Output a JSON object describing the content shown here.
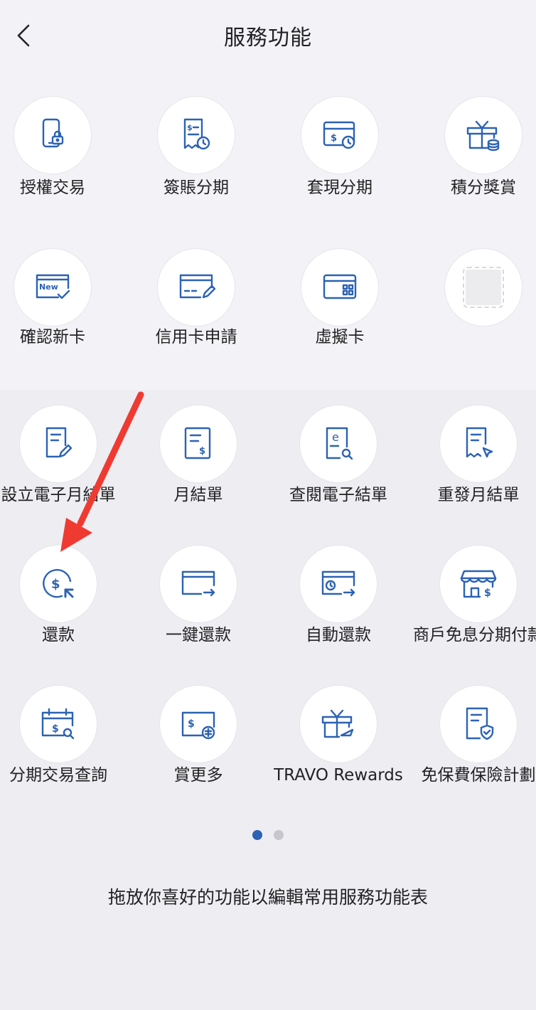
{
  "header": {
    "title": "服務功能",
    "back_icon": "chevron-left-icon"
  },
  "favorites": [
    {
      "label": "授權交易",
      "icon": "phone-lock-icon"
    },
    {
      "label": "簽賬分期",
      "icon": "receipt-clock-icon"
    },
    {
      "label": "套現分期",
      "icon": "card-dollar-clock-icon"
    },
    {
      "label": "積分獎賞",
      "icon": "gift-coins-icon"
    },
    {
      "label": "確認新卡",
      "icon": "new-card-check-icon",
      "badge": "New"
    },
    {
      "label": "信用卡申請",
      "icon": "card-pen-icon"
    },
    {
      "label": "虛擬卡",
      "icon": "card-qr-icon"
    },
    {
      "label": "",
      "icon": "empty-slot-icon"
    }
  ],
  "services": [
    {
      "label": "設立電子月結單",
      "icon": "doc-pen-icon"
    },
    {
      "label": "月結單",
      "icon": "doc-dollar-icon"
    },
    {
      "label": "查閱電子結單",
      "icon": "doc-e-search-icon"
    },
    {
      "label": "重發月結單",
      "icon": "receipt-cursor-icon"
    },
    {
      "label": "還款",
      "icon": "dollar-circle-cursor-icon"
    },
    {
      "label": "一鍵還款",
      "icon": "card-arrow-icon"
    },
    {
      "label": "自動還款",
      "icon": "card-clock-arrow-icon"
    },
    {
      "label": "商戶免息分期付款",
      "icon": "shop-dollar-icon"
    },
    {
      "label": "分期交易查詢",
      "icon": "calendar-dollar-search-icon"
    },
    {
      "label": "賞更多",
      "icon": "card-reward-icon"
    },
    {
      "label": "TRAVO Rewards",
      "icon": "gift-plane-icon"
    },
    {
      "label": "免保費保險計劃",
      "icon": "doc-shield-icon"
    }
  ],
  "pagination": {
    "pages": 2,
    "current": 1
  },
  "footer": {
    "hint": "拖放你喜好的功能以編輯常用服務功能表"
  },
  "colors": {
    "accent": "#2c62b3",
    "annotation_arrow": "#ef3a32",
    "background": "#eeedf2",
    "top_background": "#f3f2f7"
  }
}
